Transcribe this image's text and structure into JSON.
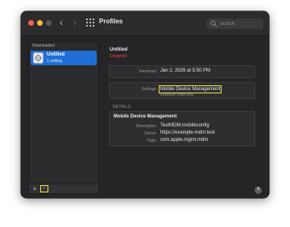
{
  "window": {
    "title": "Profiles"
  },
  "search": {
    "placeholder": "Search"
  },
  "sidebar": {
    "section": "Downloaded",
    "items": [
      {
        "name": "Untitled",
        "subtitle": "1 setting",
        "icon": "profile-gear-icon"
      }
    ],
    "add_label": "+",
    "remove_label": "−"
  },
  "profile": {
    "name": "Untitled",
    "status": "Unsigned",
    "received_label": "Received",
    "received_value": "Jan 2, 2026 at 5:50 PM",
    "settings_label": "Settings",
    "settings_value": "Mobile Device Management",
    "settings_sub": "example-mdm.test",
    "details_header": "DETAILS",
    "details_title": "Mobile Device Management",
    "details": [
      {
        "label": "Description",
        "value": "TestMDM.mobileconfig"
      },
      {
        "label": "Server",
        "value": "https://example-mdm.test"
      },
      {
        "label": "Topic",
        "value": "com.apple.mgmt.mdm"
      }
    ]
  },
  "help_label": "?",
  "colors": {
    "accent": "#1f6fd6",
    "unsigned": "#ff453a",
    "highlight": "#f5e63a"
  }
}
